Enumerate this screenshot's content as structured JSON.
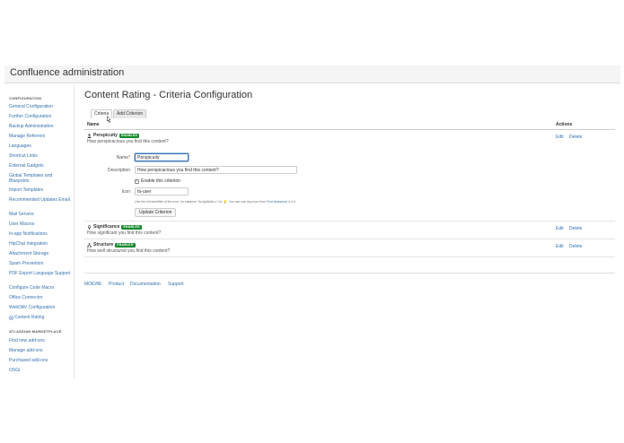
{
  "app": {
    "title": "Confluence administration"
  },
  "sidebar": {
    "heading_configuration": "CONFIGURATION",
    "items": [
      "General Configuration",
      "Further Configuration",
      "Backup Administration",
      "Manage Referrers",
      "Languages",
      "Shortcut Links",
      "External Gadgets",
      "Global Templates and Blueprints",
      "Import Templates",
      "Recommended Updates Email",
      "Mail Servers",
      "User Macros",
      "In-app Notifications",
      "HipChat Integration",
      "Attachment Storage",
      "Spam Prevention",
      "PDF Export Language Support",
      "Configure Code Macro",
      "Office Connector",
      "WebDAV Configuration",
      "Content Rating"
    ],
    "heading_marketplace": "ATLASSIAN MARKETPLACE",
    "marketplace_items": [
      "Find new add-ons",
      "Manage add-ons",
      "Purchased add-ons",
      "OSGi"
    ]
  },
  "main": {
    "title": "Content Rating - Criteria Configuration",
    "tabs": [
      {
        "label": "Criteria",
        "active": true
      },
      {
        "label": "Add Criterion",
        "active": false
      }
    ],
    "table": {
      "col_name": "Name",
      "col_actions": "Actions"
    },
    "criteria": [
      {
        "name": "Perspicuity",
        "status": "ENABLED",
        "description": "How perspicacious you find this content?",
        "icon": "user-icon",
        "edit": "Edit",
        "delete": "Delete"
      },
      {
        "name": "Significance",
        "status": "ENABLED",
        "description": "How significant you find this content?",
        "icon": "lightbulb-icon",
        "edit": "Edit",
        "delete": "Delete"
      },
      {
        "name": "Structure",
        "status": "ENABLED",
        "description": "How well structured you find this content?",
        "icon": "sitemap-icon",
        "edit": "Edit",
        "delete": "Delete"
      }
    ],
    "edit_form": {
      "name_label": "Name",
      "name_value": "Perspicuity",
      "description_label": "Description",
      "description_value": "How perspicacious you find this content?",
      "enable_label": "Enable this criterion",
      "icon_label": "Icon",
      "icon_value": "fa-user",
      "help_prefix": "Use the full identifier of the icon, for instance \"fa-lightbulb-o\" for 💡. You can use any icon from ",
      "help_link": "Font Awesome",
      "help_suffix": " 4.4.0",
      "submit_label": "Update Criterion"
    }
  },
  "footer": {
    "links": [
      "MOEWE",
      "Product",
      "Documentation",
      "Support"
    ]
  },
  "colors": {
    "link": "#3572b0",
    "lozenge": "#14892c"
  }
}
